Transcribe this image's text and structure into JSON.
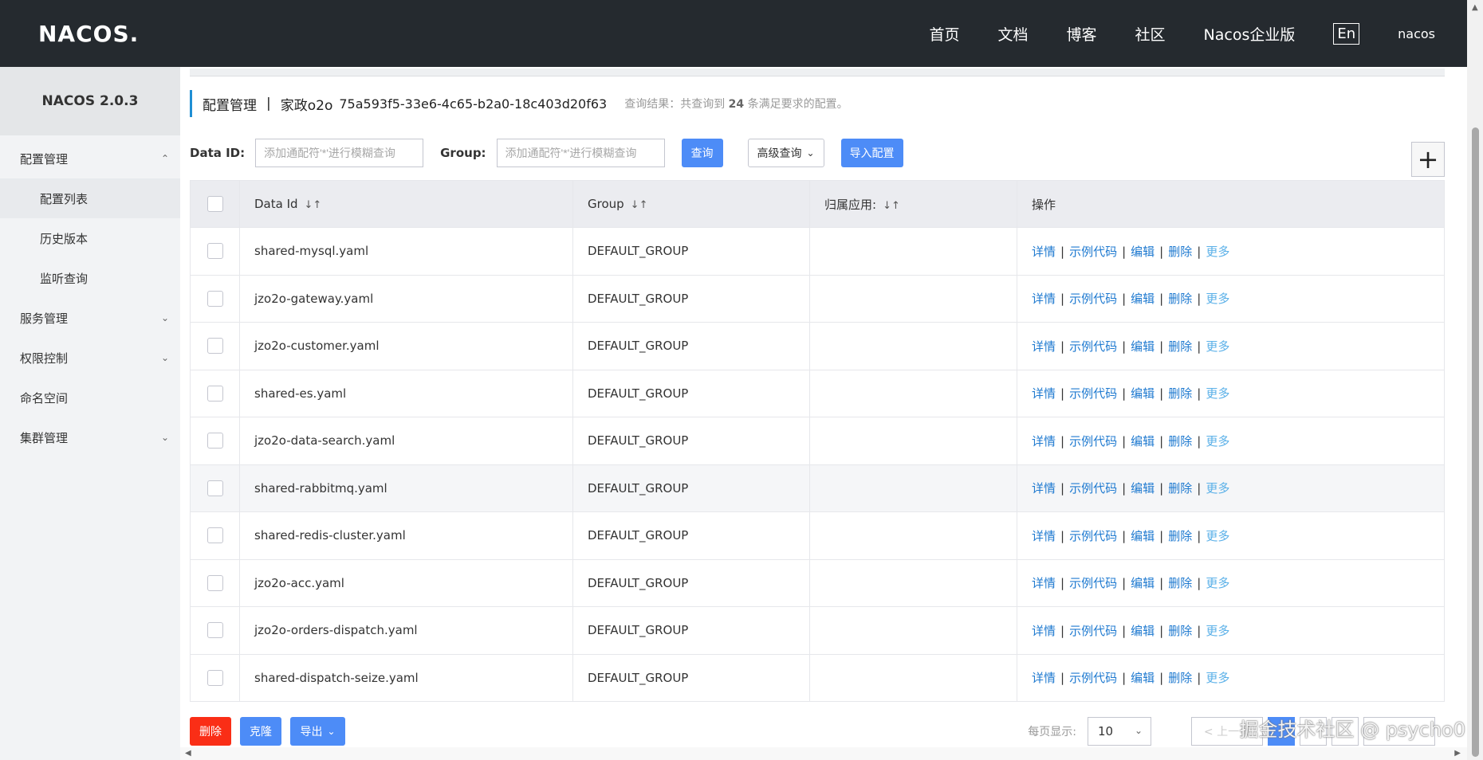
{
  "header": {
    "logo": "NACOS.",
    "nav": [
      "首页",
      "文档",
      "博客",
      "社区",
      "Nacos企业版"
    ],
    "lang": "En",
    "user": "nacos"
  },
  "sidebar": {
    "version": "NACOS 2.0.3",
    "items": [
      {
        "label": "配置管理",
        "expanded": true
      },
      {
        "label": "配置列表"
      },
      {
        "label": "历史版本"
      },
      {
        "label": "监听查询"
      },
      {
        "label": "服务管理"
      },
      {
        "label": "权限控制"
      },
      {
        "label": "命名空间"
      },
      {
        "label": "集群管理"
      }
    ]
  },
  "title": {
    "main": "配置管理",
    "sep": "|",
    "namespace": "家政o2o",
    "namespace_id": "75a593f5-33e6-4c65-b2a0-18c403d20f63",
    "result_prefix": "查询结果：共查询到",
    "result_count": "24",
    "result_suffix": "条满足要求的配置。"
  },
  "search": {
    "dataid_label": "Data ID:",
    "dataid_placeholder": "添加通配符'*'进行模糊查询",
    "group_label": "Group:",
    "group_placeholder": "添加通配符'*'进行模糊查询",
    "query_button": "查询",
    "advanced_button": "高级查询",
    "import_button": "导入配置",
    "add_button": "+"
  },
  "table": {
    "headers": {
      "dataid": "Data Id",
      "group": "Group",
      "app": "归属应用:",
      "ops": "操作"
    },
    "ops": [
      "详情",
      "示例代码",
      "编辑",
      "删除",
      "更多"
    ],
    "rows": [
      {
        "dataid": "shared-mysql.yaml",
        "group": "DEFAULT_GROUP",
        "app": ""
      },
      {
        "dataid": "jzo2o-gateway.yaml",
        "group": "DEFAULT_GROUP",
        "app": ""
      },
      {
        "dataid": "jzo2o-customer.yaml",
        "group": "DEFAULT_GROUP",
        "app": ""
      },
      {
        "dataid": "shared-es.yaml",
        "group": "DEFAULT_GROUP",
        "app": ""
      },
      {
        "dataid": "jzo2o-data-search.yaml",
        "group": "DEFAULT_GROUP",
        "app": ""
      },
      {
        "dataid": "shared-rabbitmq.yaml",
        "group": "DEFAULT_GROUP",
        "app": ""
      },
      {
        "dataid": "shared-redis-cluster.yaml",
        "group": "DEFAULT_GROUP",
        "app": ""
      },
      {
        "dataid": "jzo2o-acc.yaml",
        "group": "DEFAULT_GROUP",
        "app": ""
      },
      {
        "dataid": "jzo2o-orders-dispatch.yaml",
        "group": "DEFAULT_GROUP",
        "app": ""
      },
      {
        "dataid": "shared-dispatch-seize.yaml",
        "group": "DEFAULT_GROUP",
        "app": ""
      }
    ]
  },
  "bottom": {
    "delete_button": "删除",
    "clone_button": "克隆",
    "export_button": "导出",
    "page_size_label": "每页显示:",
    "page_size": "10",
    "prev": "< 上一页"
  },
  "watermark": "掘金技术社区 @ psycho0"
}
